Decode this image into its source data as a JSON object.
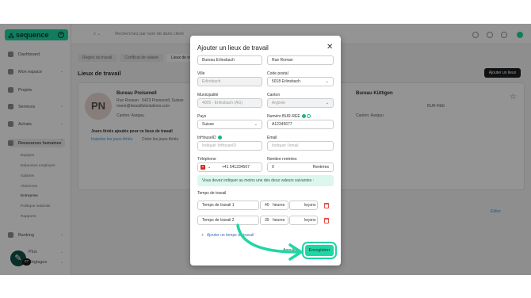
{
  "app": {
    "logo": "sequence",
    "search_placeholder": "Recherchez par nom de dans client",
    "nav": [
      {
        "label": "Dashboard"
      },
      {
        "label": "Mon espace"
      },
      {
        "label": "Projets"
      },
      {
        "label": "Services"
      },
      {
        "label": "Achats"
      },
      {
        "label": "Ressources humaines"
      },
      {
        "label": "Banking"
      },
      {
        "label": "Plus"
      },
      {
        "label": "Réglages"
      }
    ],
    "sub_nav": [
      "Équipes",
      "Dépenses employés",
      "Salaires",
      "Absences",
      "Entreprise",
      "Politique salariale",
      "Rapports"
    ],
    "help_badge": "27"
  },
  "main": {
    "tabs": [
      "Règles du travail",
      "Certificat de salaire",
      "Lieux de travail"
    ],
    "page_title": "Lieux de travail",
    "add_location": "Ajouter un lieux",
    "card": {
      "avatar": "PN",
      "title": "Bureau Preisenell",
      "address": "Rue Rousan · 5423 Preisenell, Suisse",
      "email": "marie@beautifulsolutions.com",
      "detail": "Canton: Aargau",
      "days_heading": "Jours fériés ajoutés pour ce lieux de travail",
      "import_link": "Importer les jours fériés",
      "create_link": "Créer les jours fériés",
      "right_title": "Bureau Küttigen",
      "right_ref": "BUR-REE",
      "right_detail": "Canton: Aargau",
      "edit": "Editer"
    }
  },
  "modal": {
    "title": "Ajouter un lieux de travail",
    "name_value": "Bureau Erlinsbach",
    "street_value": "Rue Roman",
    "city_label": "Ville",
    "city_value": "Erlinsbach",
    "postal_label": "Code postal",
    "postal_value": "5018 Erlinsbach",
    "municipality_label": "Municipalité",
    "municipality_value": "4005 - Erlinsbach (AG)",
    "canton_label": "Canton",
    "canton_value": "Argovie",
    "country_label": "Pays",
    "country_value": "Suisse",
    "bur_label": "Numéro BUR-REE",
    "bur_value": "A12345677",
    "inhouse_label": "InHouseID",
    "inhouse_placeholder": "Indiquer InHouseID",
    "email_label": "Email",
    "email_placeholder": "Indiquer l'email",
    "phone_label": "Téléphone",
    "phone_value": "+41 541234567",
    "entries_label": "Nombre rentrées",
    "entries_value": "0",
    "entries_unit": "Rentrées",
    "notice": "Vous devez indiquer au moins une des deux valeurs suivantes :",
    "worktime_label": "Temps de travail",
    "worktimes": [
      {
        "name": "Temps de travail 1",
        "hours": "40",
        "hours_unit": "heures",
        "lessons_unit": "leçons"
      },
      {
        "name": "Temps de travail 2",
        "hours": "35",
        "hours_unit": "heures",
        "lessons_unit": "leçons"
      }
    ],
    "add_worktime": "Ajouter un temps de travail",
    "cancel": "Annuler",
    "save": "Enregistrer"
  }
}
